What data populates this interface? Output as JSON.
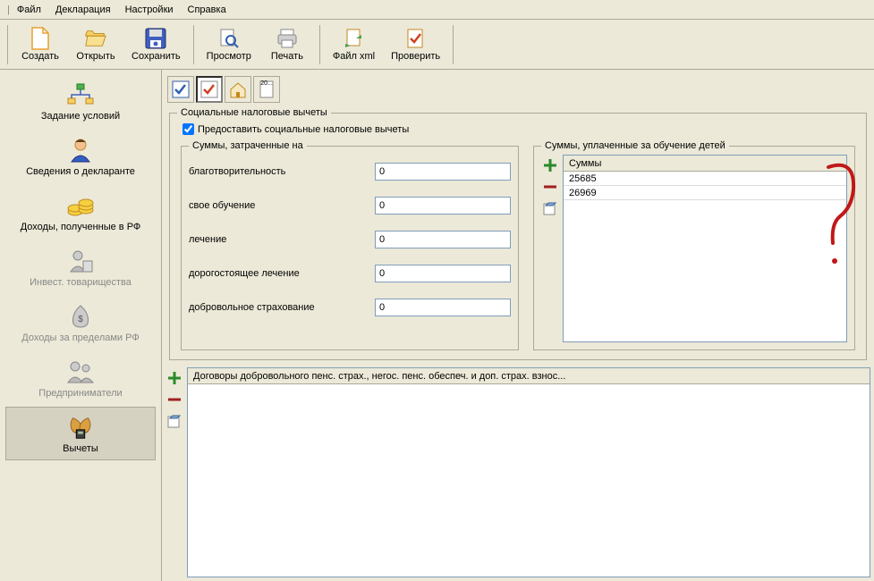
{
  "menu": {
    "file": "Файл",
    "declaration": "Декларация",
    "settings": "Настройки",
    "help": "Справка"
  },
  "toolbar": {
    "create": "Создать",
    "open": "Открыть",
    "save": "Сохранить",
    "preview": "Просмотр",
    "print": "Печать",
    "filexml": "Файл xml",
    "check": "Проверить"
  },
  "sidebar": {
    "conditions": "Задание условий",
    "declarant": "Сведения о декларанте",
    "income_rf": "Доходы, полученные в РФ",
    "invest": "Инвест. товарищества",
    "income_abroad": "Доходы за пределами РФ",
    "entrepreneurs": "Предприниматели",
    "deductions": "Вычеты"
  },
  "groups": {
    "social": "Социальные налоговые вычеты",
    "provide_social": "Предоставить социальные налоговые вычеты",
    "spent_on": "Суммы, затраченные на",
    "children_edu": "Суммы, уплаченные за обучение детей",
    "contracts": "Договоры добровольного пенс. страх., негос. пенс. обеспеч. и доп. страх. взнос..."
  },
  "labels": {
    "charity": "благотворительность",
    "own_edu": "свое обучение",
    "treatment": "лечение",
    "expensive_treatment": "дорогостоящее лечение",
    "insurance": "добровольное страхование"
  },
  "values": {
    "charity": "0",
    "own_edu": "0",
    "treatment": "0",
    "expensive_treatment": "0",
    "insurance": "0"
  },
  "children_table": {
    "header": "Суммы",
    "rows": [
      "25685",
      "26969"
    ]
  },
  "mini_toolbar_doc_label": "20..."
}
